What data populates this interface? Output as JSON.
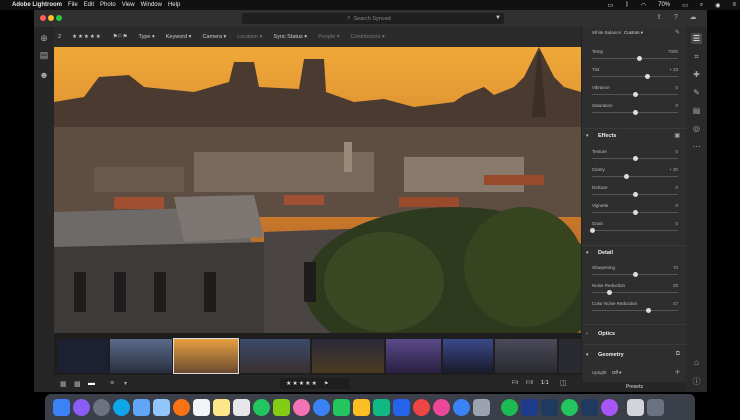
{
  "menubar": {
    "apple": "",
    "items": [
      "Adobe Lightroom",
      "File",
      "Edit",
      "Photo",
      "View",
      "Window",
      "Help"
    ],
    "battery": "70%",
    "status_icons": [
      "display-icon",
      "bluetooth-icon",
      "wifi-icon",
      "battery-icon",
      "search-icon",
      "siri-icon",
      "menu-icon"
    ]
  },
  "titlebar": {
    "search_placeholder": "Search Synced",
    "filter_icon": "funnel-icon"
  },
  "filterbar": {
    "rating_count": "2",
    "stars": "★★★★★",
    "items": [
      "Type",
      "Keyword",
      "Camera",
      "Location",
      "Sync Status",
      "People",
      "Contributors"
    ]
  },
  "edit_panel": {
    "white_balance_label": "White Balance",
    "white_balance_value": "Custom",
    "light_sliders": [
      {
        "label": "Temp",
        "value": "7000",
        "pos": 0.55
      },
      {
        "label": "Tint",
        "value": "+ 33",
        "pos": 0.65
      },
      {
        "label": "Vibrance",
        "value": "0",
        "pos": 0.5
      },
      {
        "label": "Saturation",
        "value": "0",
        "pos": 0.5
      }
    ],
    "effects_title": "Effects",
    "effects_sliders": [
      {
        "label": "Texture",
        "value": "0",
        "pos": 0.5
      },
      {
        "label": "Clarity",
        "value": "+ 30",
        "pos": 0.4
      },
      {
        "label": "Dehaze",
        "value": "0",
        "pos": 0.5
      },
      {
        "label": "Vignette",
        "value": "0",
        "pos": 0.5
      },
      {
        "label": "Grain",
        "value": "0",
        "pos": 0.0
      }
    ],
    "detail_title": "Detail",
    "detail_sliders": [
      {
        "label": "Sharpening",
        "value": "70",
        "pos": 0.5
      },
      {
        "label": "Noise Reduction",
        "value": "20",
        "pos": 0.2
      },
      {
        "label": "Color Noise Reduction",
        "value": "47",
        "pos": 0.66
      }
    ],
    "optics_title": "Optics",
    "geometry_title": "Geometry",
    "upright_label": "Upright",
    "upright_value": "Off",
    "presets_label": "Presets"
  },
  "bottombar": {
    "stars": "★★★★★",
    "fit_label": "Fit",
    "fill_label": "Fill",
    "ratio_label": "1:1"
  },
  "colors": {
    "sky_top": "#e9a030",
    "sky_bottom": "#cf7a20",
    "accent_blue": "#2a6fdb"
  }
}
